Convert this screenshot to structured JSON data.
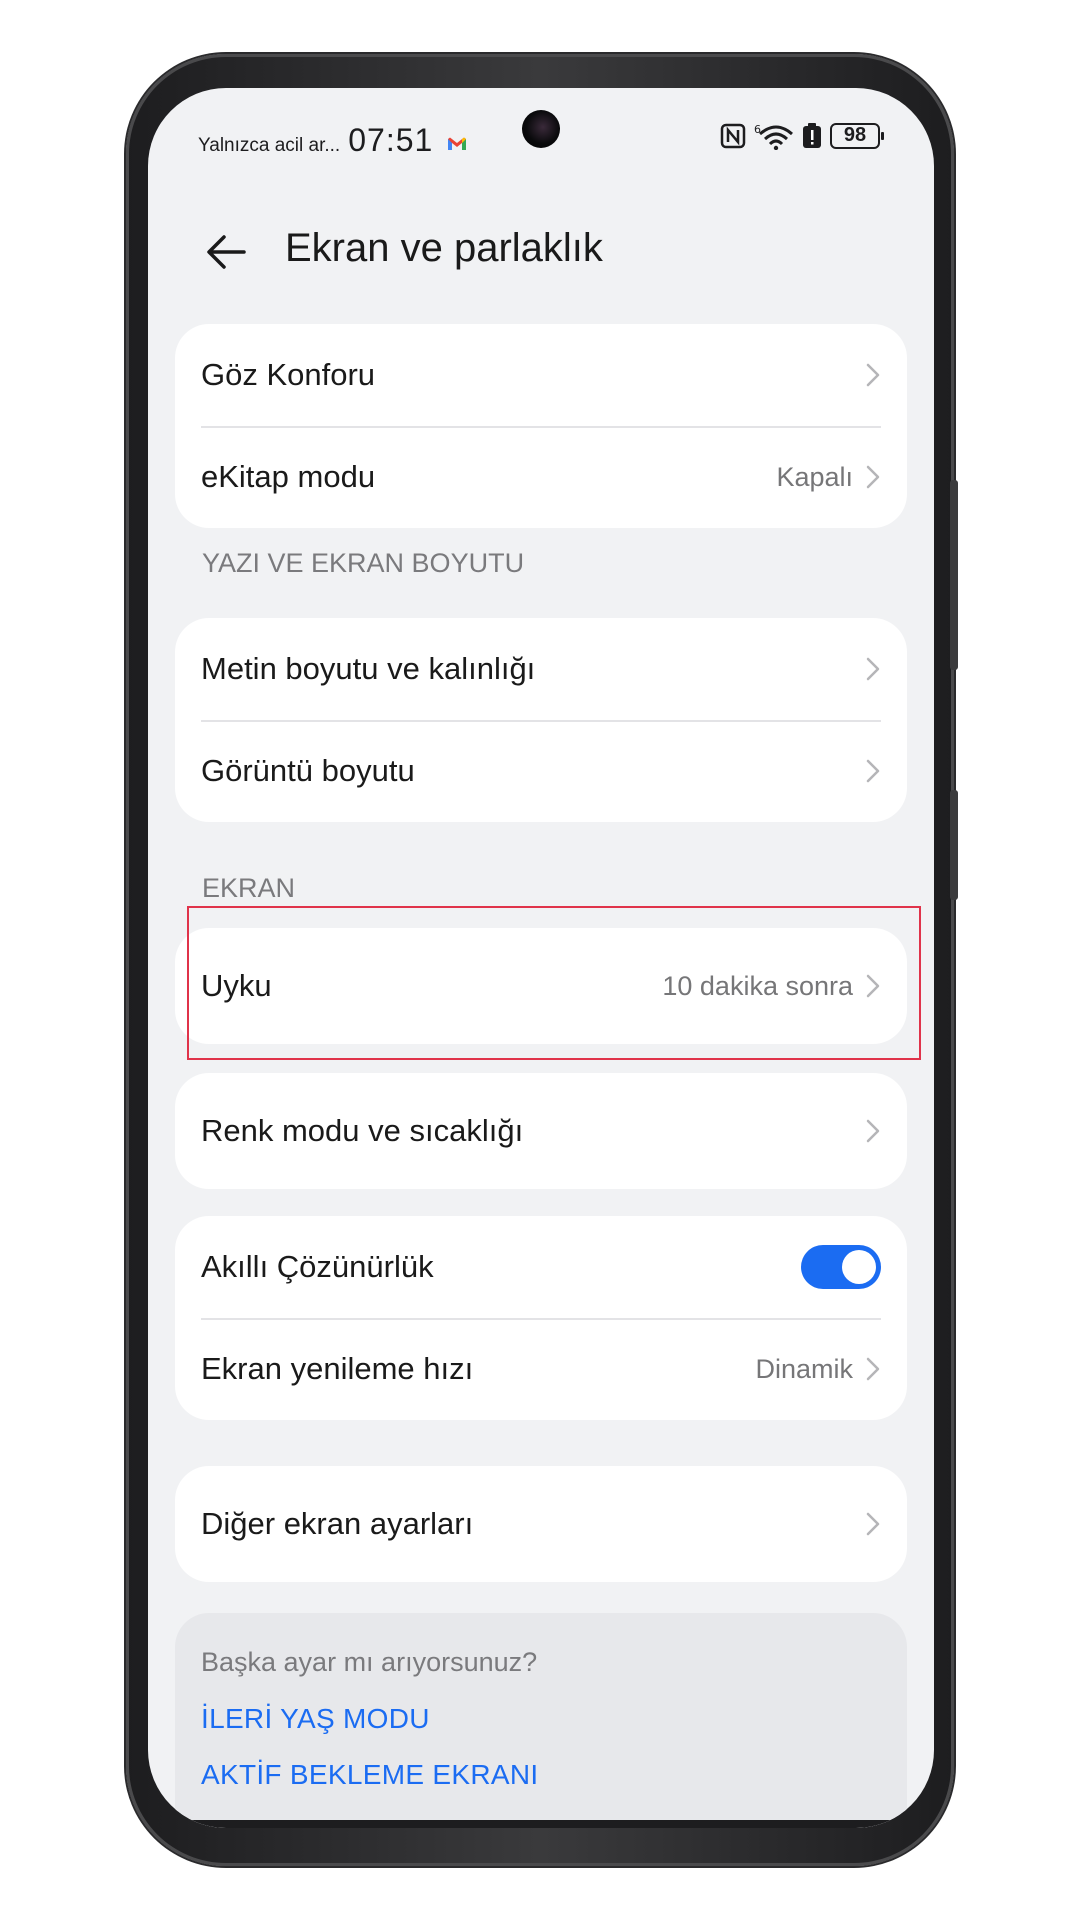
{
  "status_bar": {
    "carrier_text": "Yalnızca acil ar...",
    "time": "07:51",
    "battery_level": "98"
  },
  "header": {
    "title": "Ekran ve parlaklık"
  },
  "group_top": {
    "items": [
      {
        "label": "Göz Konforu",
        "value": ""
      },
      {
        "label": "eKitap modu",
        "value": "Kapalı"
      }
    ]
  },
  "section_text_size": {
    "title": "YAZI VE EKRAN BOYUTU",
    "items": [
      {
        "label": "Metin boyutu ve kalınlığı"
      },
      {
        "label": "Görüntü boyutu"
      }
    ]
  },
  "section_screen": {
    "title": "EKRAN",
    "sleep": {
      "label": "Uyku",
      "value": "10 dakika sonra"
    },
    "color_mode": {
      "label": "Renk modu ve sıcaklığı"
    },
    "smart_resolution": {
      "label": "Akıllı Çözünürlük",
      "enabled": true
    },
    "refresh_rate": {
      "label": "Ekran yenileme hızı",
      "value": "Dinamik"
    },
    "other": {
      "label": "Diğer ekran ayarları"
    }
  },
  "suggestions": {
    "title": "Başka ayar mı arıyorsunuz?",
    "links": [
      "İLERİ YAŞ MODU",
      "AKTİF BEKLEME EKRANI"
    ]
  },
  "colors": {
    "accent": "#1b6cf2",
    "highlight": "#e0334a",
    "background": "#f1f2f4"
  }
}
